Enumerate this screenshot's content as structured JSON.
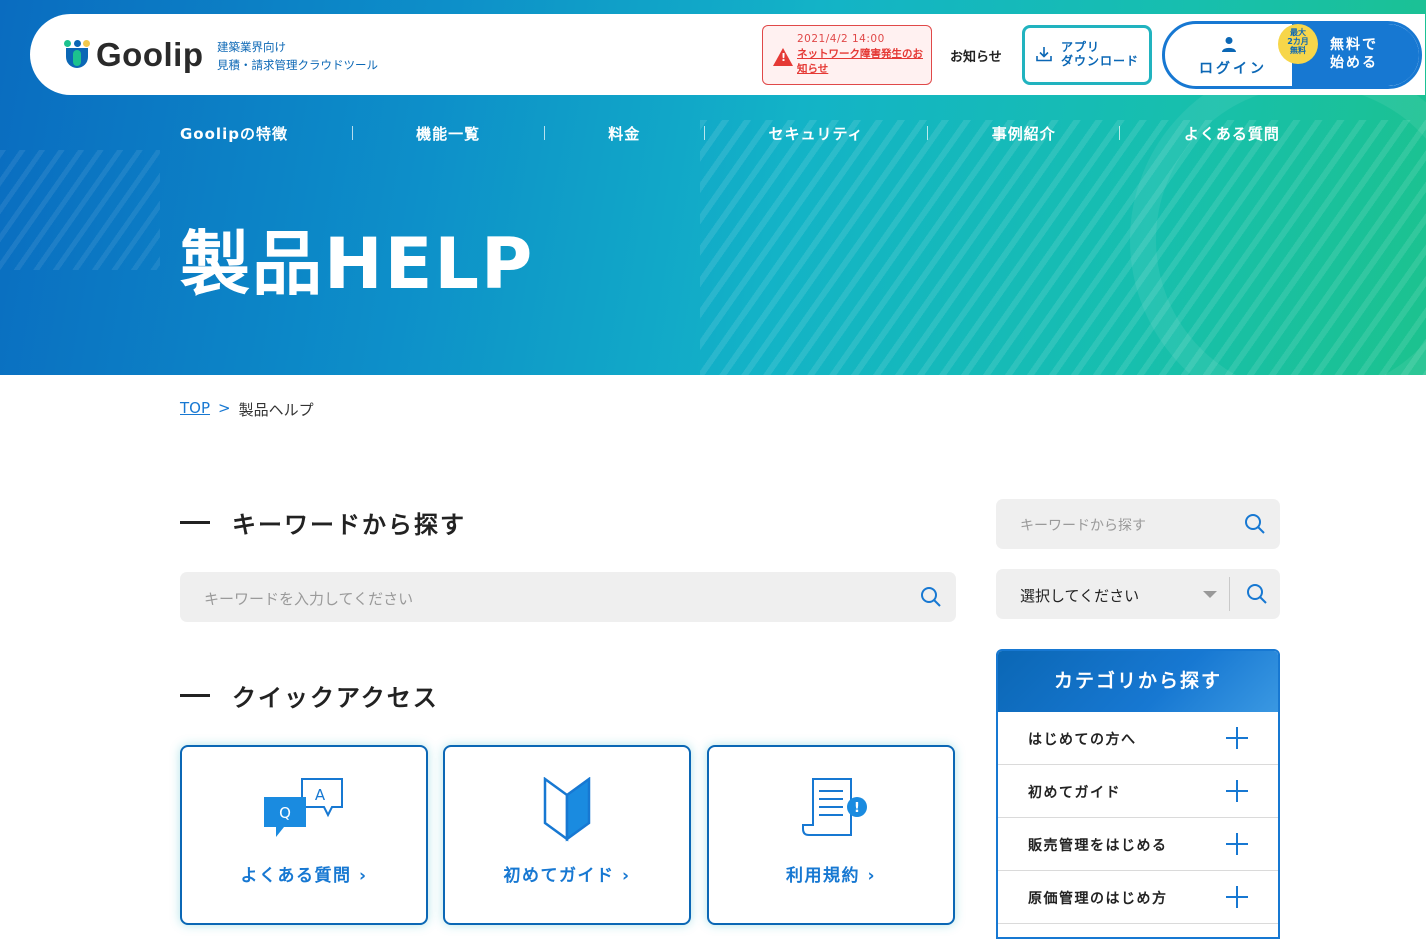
{
  "header": {
    "logo_text": "Goolip",
    "tagline_line1": "建築業界向け",
    "tagline_line2": "見積・請求管理クラウドツール",
    "alert": {
      "date": "2021/4/2 14:00",
      "link": "ネットワーク障害発生のお知らせ"
    },
    "news_label": "お知らせ",
    "app_download_line1": "アプリ",
    "app_download_line2": "ダウンロード",
    "login_label": "ログイン",
    "start_line1": "無料で",
    "start_line2": "始める",
    "badge_line1": "最大",
    "badge_line2": "2カ月",
    "badge_line3": "無料"
  },
  "nav": {
    "items": [
      "Goolipの特徴",
      "機能一覧",
      "料金",
      "セキュリティ",
      "事例紹介",
      "よくある質問"
    ]
  },
  "hero": {
    "title": "製品HELP"
  },
  "breadcrumb": {
    "top": "TOP",
    "separator": ">",
    "current": "製品ヘルプ"
  },
  "keyword_section": {
    "heading": "キーワードから探す",
    "placeholder": "キーワードを入力してください"
  },
  "quick_access": {
    "heading": "クイックアクセス",
    "cards": [
      {
        "label": "よくある質問",
        "icon": "qa-bubbles-icon"
      },
      {
        "label": "初めてガイド",
        "icon": "beginner-mark-icon"
      },
      {
        "label": "利用規約",
        "icon": "terms-document-icon"
      }
    ]
  },
  "sidebar": {
    "search_placeholder": "キーワードから探す",
    "select_value": "選択してください",
    "category_heading": "カテゴリから探す",
    "categories": [
      "はじめての方へ",
      "初めてガイド",
      "販売管理をはじめる",
      "原価管理のはじめ方"
    ]
  },
  "colors": {
    "brand_blue": "#1778d2",
    "brand_dark_blue": "#0b67b5",
    "teal": "#21b3bf",
    "alert_red": "#e53935",
    "badge_yellow": "#f7d64a"
  }
}
